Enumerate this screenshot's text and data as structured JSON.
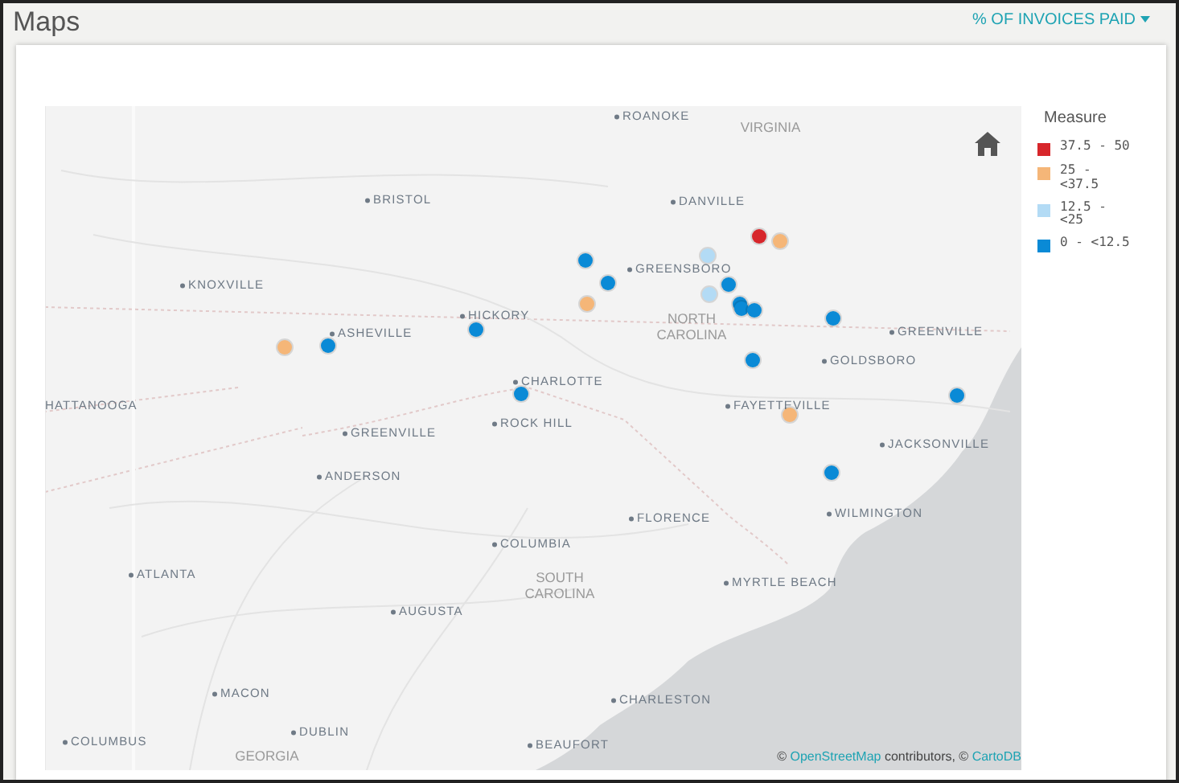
{
  "header": {
    "title": "Maps",
    "measure_menu": "% OF INVOICES PAID"
  },
  "map": {
    "labels": [
      {
        "text": "ROANOKE",
        "kind": "city"
      },
      {
        "text": "VIRGINIA",
        "kind": "region"
      },
      {
        "text": "BRISTOL",
        "kind": "city"
      },
      {
        "text": "DANVILLE",
        "kind": "city"
      },
      {
        "text": "KNOXVILLE",
        "kind": "city"
      },
      {
        "text": "GREENSBORO",
        "kind": "city"
      },
      {
        "text": "HICKORY",
        "kind": "city"
      },
      {
        "text": "ASHEVILLE",
        "kind": "city"
      },
      {
        "text": "NORTH CAROLINA",
        "kind": "region"
      },
      {
        "text": "CHARLOTTE",
        "kind": "city"
      },
      {
        "text": "HATTANOOGA",
        "kind": "cut"
      },
      {
        "text": "ROCK HILL",
        "kind": "city"
      },
      {
        "text": "GREENVILLE",
        "kind": "city"
      },
      {
        "text": "GOLDSBORO",
        "kind": "city"
      },
      {
        "text": "FAYETTEVILLE",
        "kind": "city"
      },
      {
        "text": "JACKSONVILLE",
        "kind": "city"
      },
      {
        "text": "GREENVILLE",
        "kind": "city"
      },
      {
        "text": "ANDERSON",
        "kind": "city"
      },
      {
        "text": "WILMINGTON",
        "kind": "city"
      },
      {
        "text": "FLORENCE",
        "kind": "city"
      },
      {
        "text": "COLUMBIA",
        "kind": "city"
      },
      {
        "text": "SOUTH CAROLINA",
        "kind": "region"
      },
      {
        "text": "MYRTLE BEACH",
        "kind": "city"
      },
      {
        "text": "ATLANTA",
        "kind": "city"
      },
      {
        "text": "AUGUSTA",
        "kind": "city"
      },
      {
        "text": "CHARLESTON",
        "kind": "city"
      },
      {
        "text": "MACON",
        "kind": "city"
      },
      {
        "text": "DUBLIN",
        "kind": "city"
      },
      {
        "text": "COLUMBUS",
        "kind": "city"
      },
      {
        "text": "GEORGIA",
        "kind": "region"
      },
      {
        "text": "BEAUFORT",
        "kind": "city"
      }
    ],
    "points": [
      {
        "color": "#d7262b"
      },
      {
        "color": "#f5b678"
      },
      {
        "color": "#0a8ad6"
      },
      {
        "color": "#0a8ad6"
      },
      {
        "color": "#b3dbf5"
      },
      {
        "color": "#0a8ad6"
      },
      {
        "color": "#b3dbf5"
      },
      {
        "color": "#f5b678"
      },
      {
        "color": "#0a8ad6"
      },
      {
        "color": "#0a8ad6"
      },
      {
        "color": "#0a8ad6"
      },
      {
        "color": "#0a8ad6"
      },
      {
        "color": "#0a8ad6"
      },
      {
        "color": "#0a8ad6"
      },
      {
        "color": "#0a8ad6"
      },
      {
        "color": "#f5b678"
      },
      {
        "color": "#0a8ad6"
      },
      {
        "color": "#f5b678"
      },
      {
        "color": "#0a8ad6"
      },
      {
        "color": "#0a8ad6"
      }
    ],
    "attribution": {
      "prefix": "©",
      "link_1": "OpenStreetMap",
      "middle": "contributors, ©",
      "link_2": "CartoDB"
    }
  },
  "legend": {
    "title": "Measure",
    "items": [
      {
        "label": "37.5 - 50",
        "color": "#d7262b"
      },
      {
        "label": "25 - <37.5",
        "color": "#f5b678"
      },
      {
        "label": "12.5 - <25",
        "color": "#b3dbf5"
      },
      {
        "label": "0 - <12.5",
        "color": "#0a8ad6"
      }
    ]
  }
}
